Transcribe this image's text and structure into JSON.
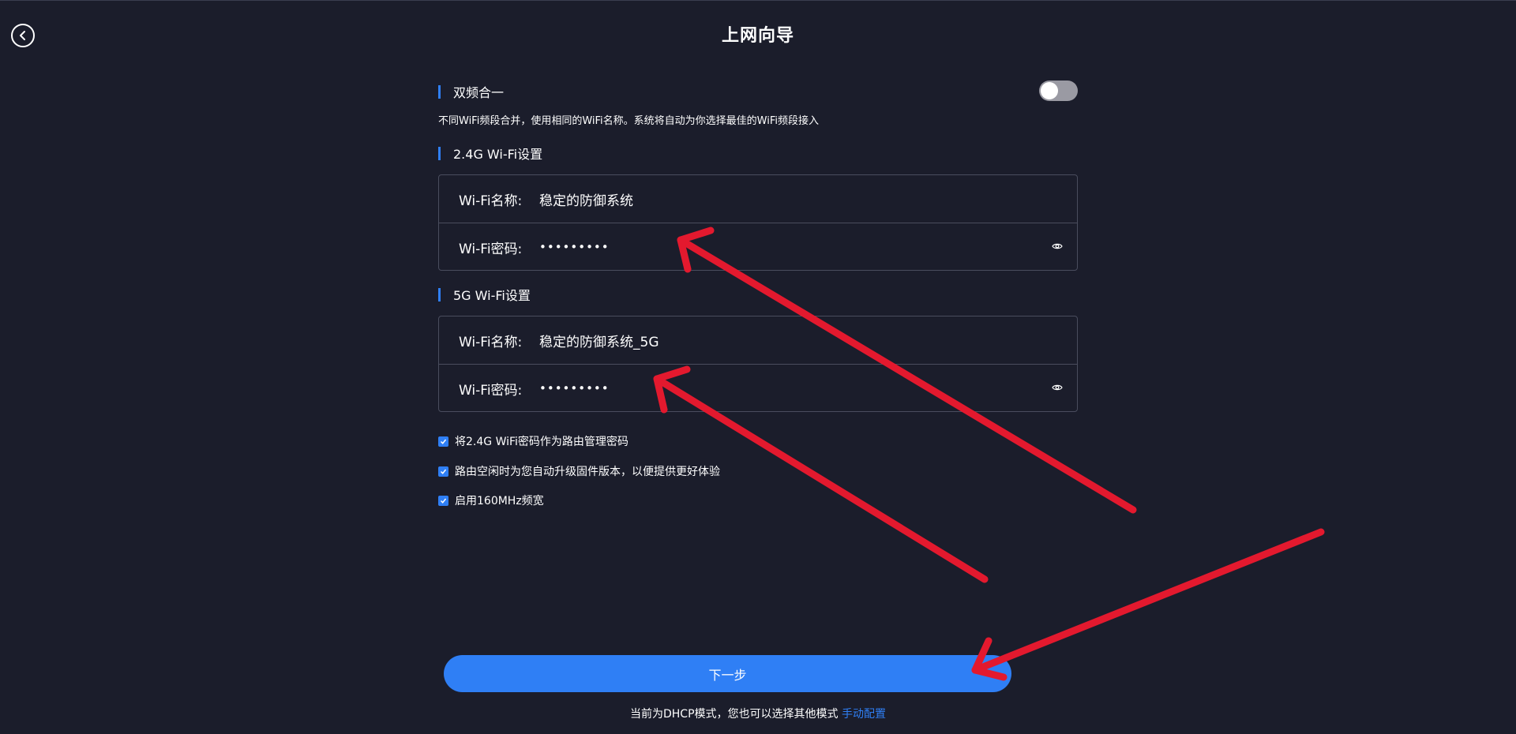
{
  "header": {
    "title": "上网向导"
  },
  "dual_band": {
    "label": "双频合一",
    "enabled": false,
    "description": "不同WiFi频段合并，使用相同的WiFi名称。系统将自动为你选择最佳的WiFi频段接入"
  },
  "wifi_24g": {
    "section_title": "2.4G Wi-Fi设置",
    "name_label": "Wi-Fi名称:",
    "name_value": "稳定的防御系统",
    "password_label": "Wi-Fi密码:",
    "password_value": "•••••••••"
  },
  "wifi_5g": {
    "section_title": "5G Wi-Fi设置",
    "name_label": "Wi-Fi名称:",
    "name_value": "稳定的防御系统_5G",
    "password_label": "Wi-Fi密码:",
    "password_value": "•••••••••"
  },
  "options": [
    {
      "label": "将2.4G WiFi密码作为路由管理密码",
      "checked": true
    },
    {
      "label": "路由空闲时为您自动升级固件版本，以便提供更好体验",
      "checked": true
    },
    {
      "label": "启用160MHz频宽",
      "checked": true
    }
  ],
  "next_button": "下一步",
  "footer": {
    "note": "当前为DHCP模式，您也可以选择其他模式",
    "link": "手动配置"
  },
  "colors": {
    "background": "#1b1d2b",
    "accent": "#2f7ff5",
    "annotation_arrow": "#e3192e"
  },
  "icons": [
    "back-icon",
    "eye-icon",
    "check-icon",
    "annotation-arrow"
  ]
}
